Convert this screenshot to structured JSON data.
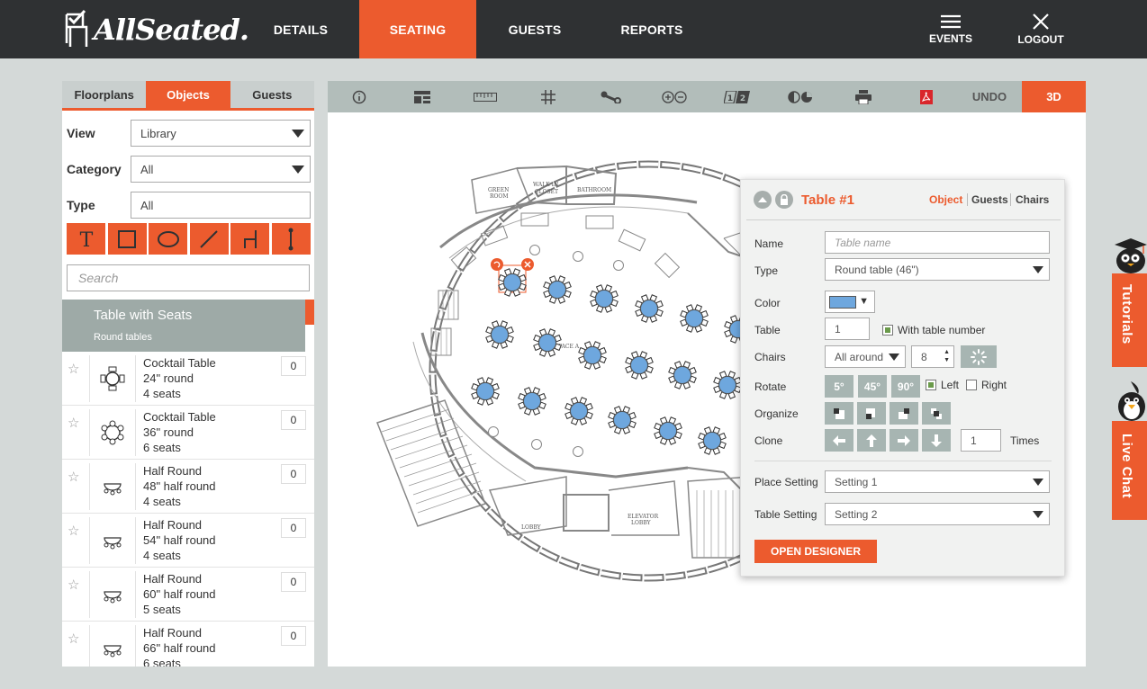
{
  "brand": {
    "name": "AllSeated.",
    "accent": "#ec5b2e"
  },
  "nav": {
    "tabs": [
      "DETAILS",
      "SEATING",
      "GUESTS",
      "REPORTS"
    ],
    "active": "SEATING",
    "events_label": "EVENTS",
    "logout_label": "LOGOUT"
  },
  "left_panel": {
    "tabs": [
      "Floorplans",
      "Objects",
      "Guests"
    ],
    "active_tab": "Objects",
    "view_label": "View",
    "view_value": "Library",
    "category_label": "Category",
    "category_value": "All",
    "type_label": "Type",
    "type_value": "All",
    "shape_tools": [
      "text-tool",
      "rectangle-tool",
      "ellipse-tool",
      "line-tool",
      "chair-tool",
      "pole-tool"
    ],
    "search_placeholder": "Search",
    "category_header": {
      "title": "Table with Seats",
      "subtitle": "Round tables"
    },
    "items": [
      {
        "name": "Cocktail Table",
        "size": "24\" round",
        "seats": "4 seats",
        "count": "0"
      },
      {
        "name": "Cocktail Table",
        "size": "36\" round",
        "seats": "6 seats",
        "count": "0"
      },
      {
        "name": "Half Round",
        "size": "48\" half round",
        "seats": "4 seats",
        "count": "0"
      },
      {
        "name": "Half Round",
        "size": "54\" half round",
        "seats": "4 seats",
        "count": "0"
      },
      {
        "name": "Half Round",
        "size": "60\" half round",
        "seats": "5 seats",
        "count": "0"
      },
      {
        "name": "Half Round",
        "size": "66\" half round",
        "seats": "6 seats",
        "count": "0"
      }
    ]
  },
  "toolbar": {
    "icons": [
      "info-icon",
      "layout-icon",
      "ruler-icon",
      "grid-icon",
      "wrench-icon",
      "zoom-icon",
      "numbering-icon",
      "display-icon",
      "print-icon",
      "pdf-icon"
    ],
    "undo_label": "UNDO",
    "view3d_label": "3D"
  },
  "floorplan": {
    "room_labels": [
      "GREEN ROOM",
      "WALK IN CLOSET",
      "BATHROOM",
      "SPACE A",
      "LOBBY",
      "ELEVATOR LOBBY"
    ],
    "table_color": "#6ea7de"
  },
  "table_panel": {
    "title": "Table #1",
    "tabs": [
      "Object",
      "Guests",
      "Chairs"
    ],
    "active_tab": "Object",
    "name_label": "Name",
    "name_placeholder": "Table name",
    "type_label": "Type",
    "type_value": "Round table (46\")",
    "color_label": "Color",
    "color_value": "#6ea7de",
    "table_label": "Table",
    "table_number": "1",
    "with_table_number": "With table number",
    "chairs_label": "Chairs",
    "chairs_mode": "All around",
    "chairs_count": "8",
    "rotate_label": "Rotate",
    "rotate_buttons": [
      "5°",
      "45°",
      "90°"
    ],
    "rotate_left": "Left",
    "rotate_right": "Right",
    "organize_label": "Organize",
    "clone_label": "Clone",
    "clone_times": "1",
    "clone_times_label": "Times",
    "place_setting_label": "Place Setting",
    "place_setting_value": "Setting 1",
    "table_setting_label": "Table Setting",
    "table_setting_value": "Setting 2",
    "designer_label": "OPEN DESIGNER"
  },
  "side_tabs": {
    "tutorials": "Tutorials",
    "live_chat": "Live Chat"
  }
}
